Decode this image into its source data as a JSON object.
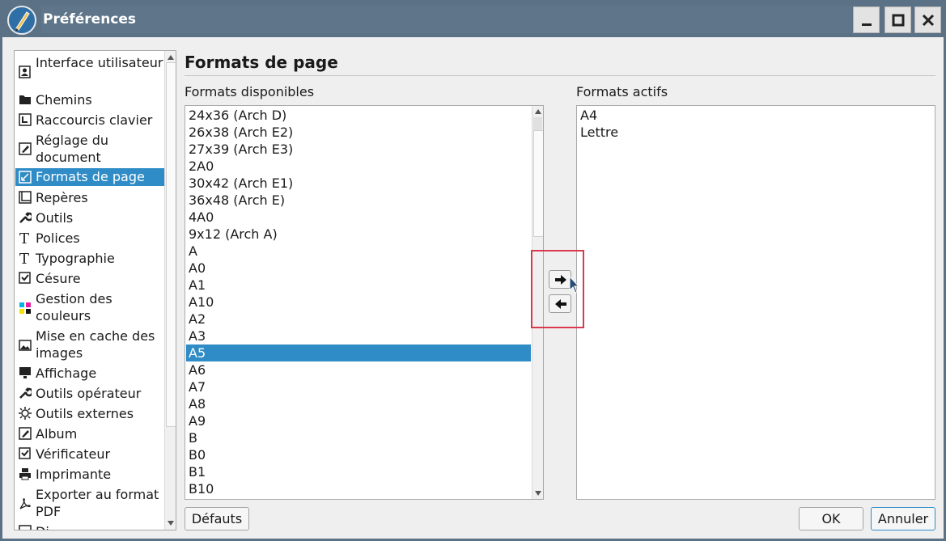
{
  "window": {
    "title": "Préférences"
  },
  "titlebar_buttons": [
    "minimize-icon",
    "maximize-icon",
    "close-icon"
  ],
  "sidebar": {
    "items": [
      {
        "label": "Interface utilisateur",
        "icon": "user-interface-icon"
      },
      {
        "label": "Chemins",
        "icon": "folder-icon"
      },
      {
        "label": "Raccourcis clavier",
        "icon": "keyboard-shortcut-icon"
      },
      {
        "label": "Réglage du document",
        "icon": "document-settings-icon"
      },
      {
        "label": "Formats de page",
        "icon": "page-size-icon",
        "selected": true
      },
      {
        "label": "Repères",
        "icon": "guides-icon"
      },
      {
        "label": "Outils",
        "icon": "wrench-icon"
      },
      {
        "label": "Polices",
        "icon": "font-icon"
      },
      {
        "label": "Typographie",
        "icon": "typography-icon"
      },
      {
        "label": "Césure",
        "icon": "checkbox-icon"
      },
      {
        "label": "Gestion des couleurs",
        "icon": "color-management-icon"
      },
      {
        "label": "Mise en cache des images",
        "icon": "image-cache-icon"
      },
      {
        "label": "Affichage",
        "icon": "monitor-icon"
      },
      {
        "label": "Outils opérateur",
        "icon": "wrench-icon"
      },
      {
        "label": "Outils externes",
        "icon": "gear-icon"
      },
      {
        "label": "Album",
        "icon": "album-icon"
      },
      {
        "label": "Vérificateur",
        "icon": "checkbox-icon"
      },
      {
        "label": "Imprimante",
        "icon": "printer-icon"
      },
      {
        "label": "Exporter au format PDF",
        "icon": "pdf-icon"
      },
      {
        "label": "Di",
        "icon": "document-icon"
      }
    ]
  },
  "main": {
    "heading": "Formats de page",
    "available_label": "Formats disponibles",
    "active_label": "Formats actifs",
    "available_formats": [
      "24x36 (Arch D)",
      "26x38 (Arch E2)",
      "27x39 (Arch E3)",
      "2A0",
      "30x42 (Arch E1)",
      "36x48 (Arch E)",
      "4A0",
      "9x12 (Arch A)",
      "A",
      "A0",
      "A1",
      "A10",
      "A2",
      "A3",
      "A5",
      "A6",
      "A7",
      "A8",
      "A9",
      "B",
      "B0",
      "B1",
      "B10"
    ],
    "available_selected": "A5",
    "active_formats": [
      "A4",
      "Lettre"
    ],
    "move_buttons": [
      "arrow-right-icon",
      "arrow-left-icon"
    ]
  },
  "footer": {
    "defaults_label": "Défauts",
    "ok_label": "OK",
    "cancel_label": "Annuler"
  },
  "colors": {
    "titlebar": "#5b7186",
    "selection": "#308cc6",
    "highlight_box": "#d9394e"
  }
}
